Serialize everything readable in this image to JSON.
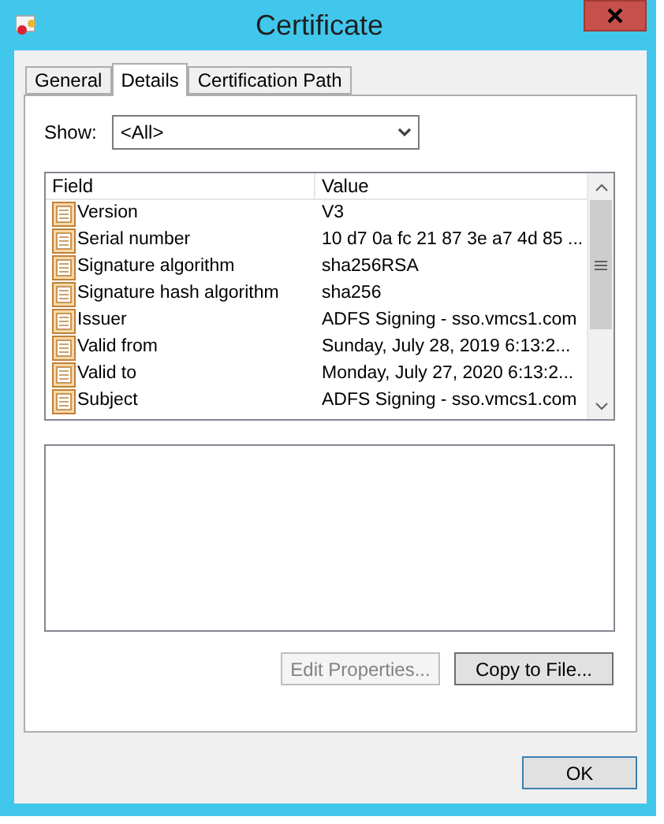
{
  "window": {
    "title": "Certificate"
  },
  "tabs": [
    {
      "label": "General",
      "selected": false
    },
    {
      "label": "Details",
      "selected": true
    },
    {
      "label": "Certification Path",
      "selected": false
    }
  ],
  "show": {
    "label": "Show:",
    "value": "<All>"
  },
  "table": {
    "columns": [
      "Field",
      "Value"
    ],
    "rows": [
      {
        "field": "Version",
        "value": "V3"
      },
      {
        "field": "Serial number",
        "value": "10 d7 0a fc 21 87 3e a7 4d 85 ..."
      },
      {
        "field": "Signature algorithm",
        "value": "sha256RSA"
      },
      {
        "field": "Signature hash algorithm",
        "value": "sha256"
      },
      {
        "field": "Issuer",
        "value": "ADFS Signing - sso.vmcs1.com"
      },
      {
        "field": "Valid from",
        "value": "Sunday, July 28, 2019 6:13:2..."
      },
      {
        "field": "Valid to",
        "value": "Monday, July 27, 2020 6:13:2..."
      },
      {
        "field": "Subject",
        "value": "ADFS Signing - sso.vmcs1.com"
      }
    ]
  },
  "buttons": [
    {
      "label": "Edit Properties...",
      "disabled": true
    },
    {
      "label": "Copy to File...",
      "disabled": false
    }
  ],
  "ok": {
    "label": "OK"
  }
}
